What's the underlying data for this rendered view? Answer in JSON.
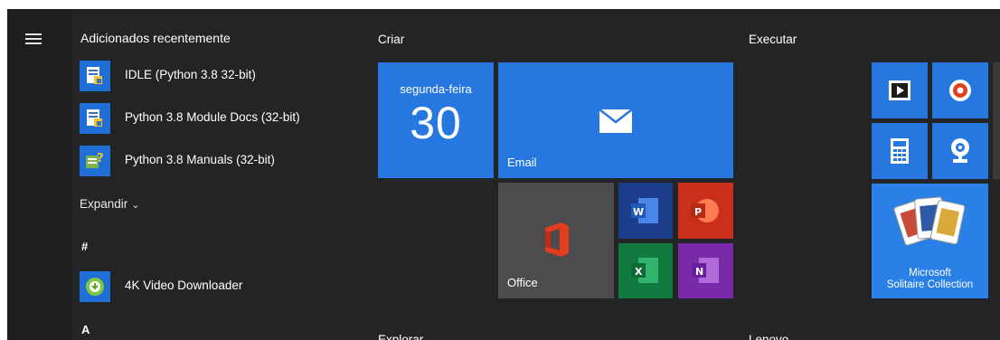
{
  "colors": {
    "panel": "#232425",
    "tile_blue": "#2678e0",
    "tile_gray": "#4c4c4c",
    "text": "#ffffff"
  },
  "start_menu": {
    "menu_icon": "hamburger-icon",
    "recent_header": "Adicionados recentemente",
    "recent_apps": [
      {
        "label": "IDLE (Python 3.8 32-bit)",
        "icon": "python-idle-icon"
      },
      {
        "label": "Python 3.8 Module Docs (32-bit)",
        "icon": "python-docs-icon"
      },
      {
        "label": "Python 3.8 Manuals (32-bit)",
        "icon": "python-manuals-icon"
      }
    ],
    "expand_label": "Expandir",
    "groups": [
      {
        "letter": "#",
        "apps": [
          {
            "label": "4K Video Downloader",
            "icon": "4k-video-downloader-icon"
          }
        ]
      },
      {
        "letter": "A",
        "apps": []
      }
    ]
  },
  "tiles": {
    "criar": {
      "title": "Criar",
      "calendar": {
        "day": "segunda-feira",
        "date": "30"
      },
      "email": {
        "label": "Email"
      },
      "office": {
        "label": "Office"
      },
      "office_apps": [
        "word-icon",
        "powerpoint-icon",
        "excel-icon",
        "onenote-icon"
      ]
    },
    "executar": {
      "title": "Executar",
      "small_tiles": [
        "movies-tv-icon",
        "groove-music-icon",
        "calculator-icon",
        "camera-icon"
      ],
      "solitaire": {
        "line1": "Microsoft",
        "line2": "Solitaire Collection"
      }
    },
    "explorar": {
      "title": "Explorar"
    },
    "lenovo": {
      "title": "Lenovo"
    }
  }
}
